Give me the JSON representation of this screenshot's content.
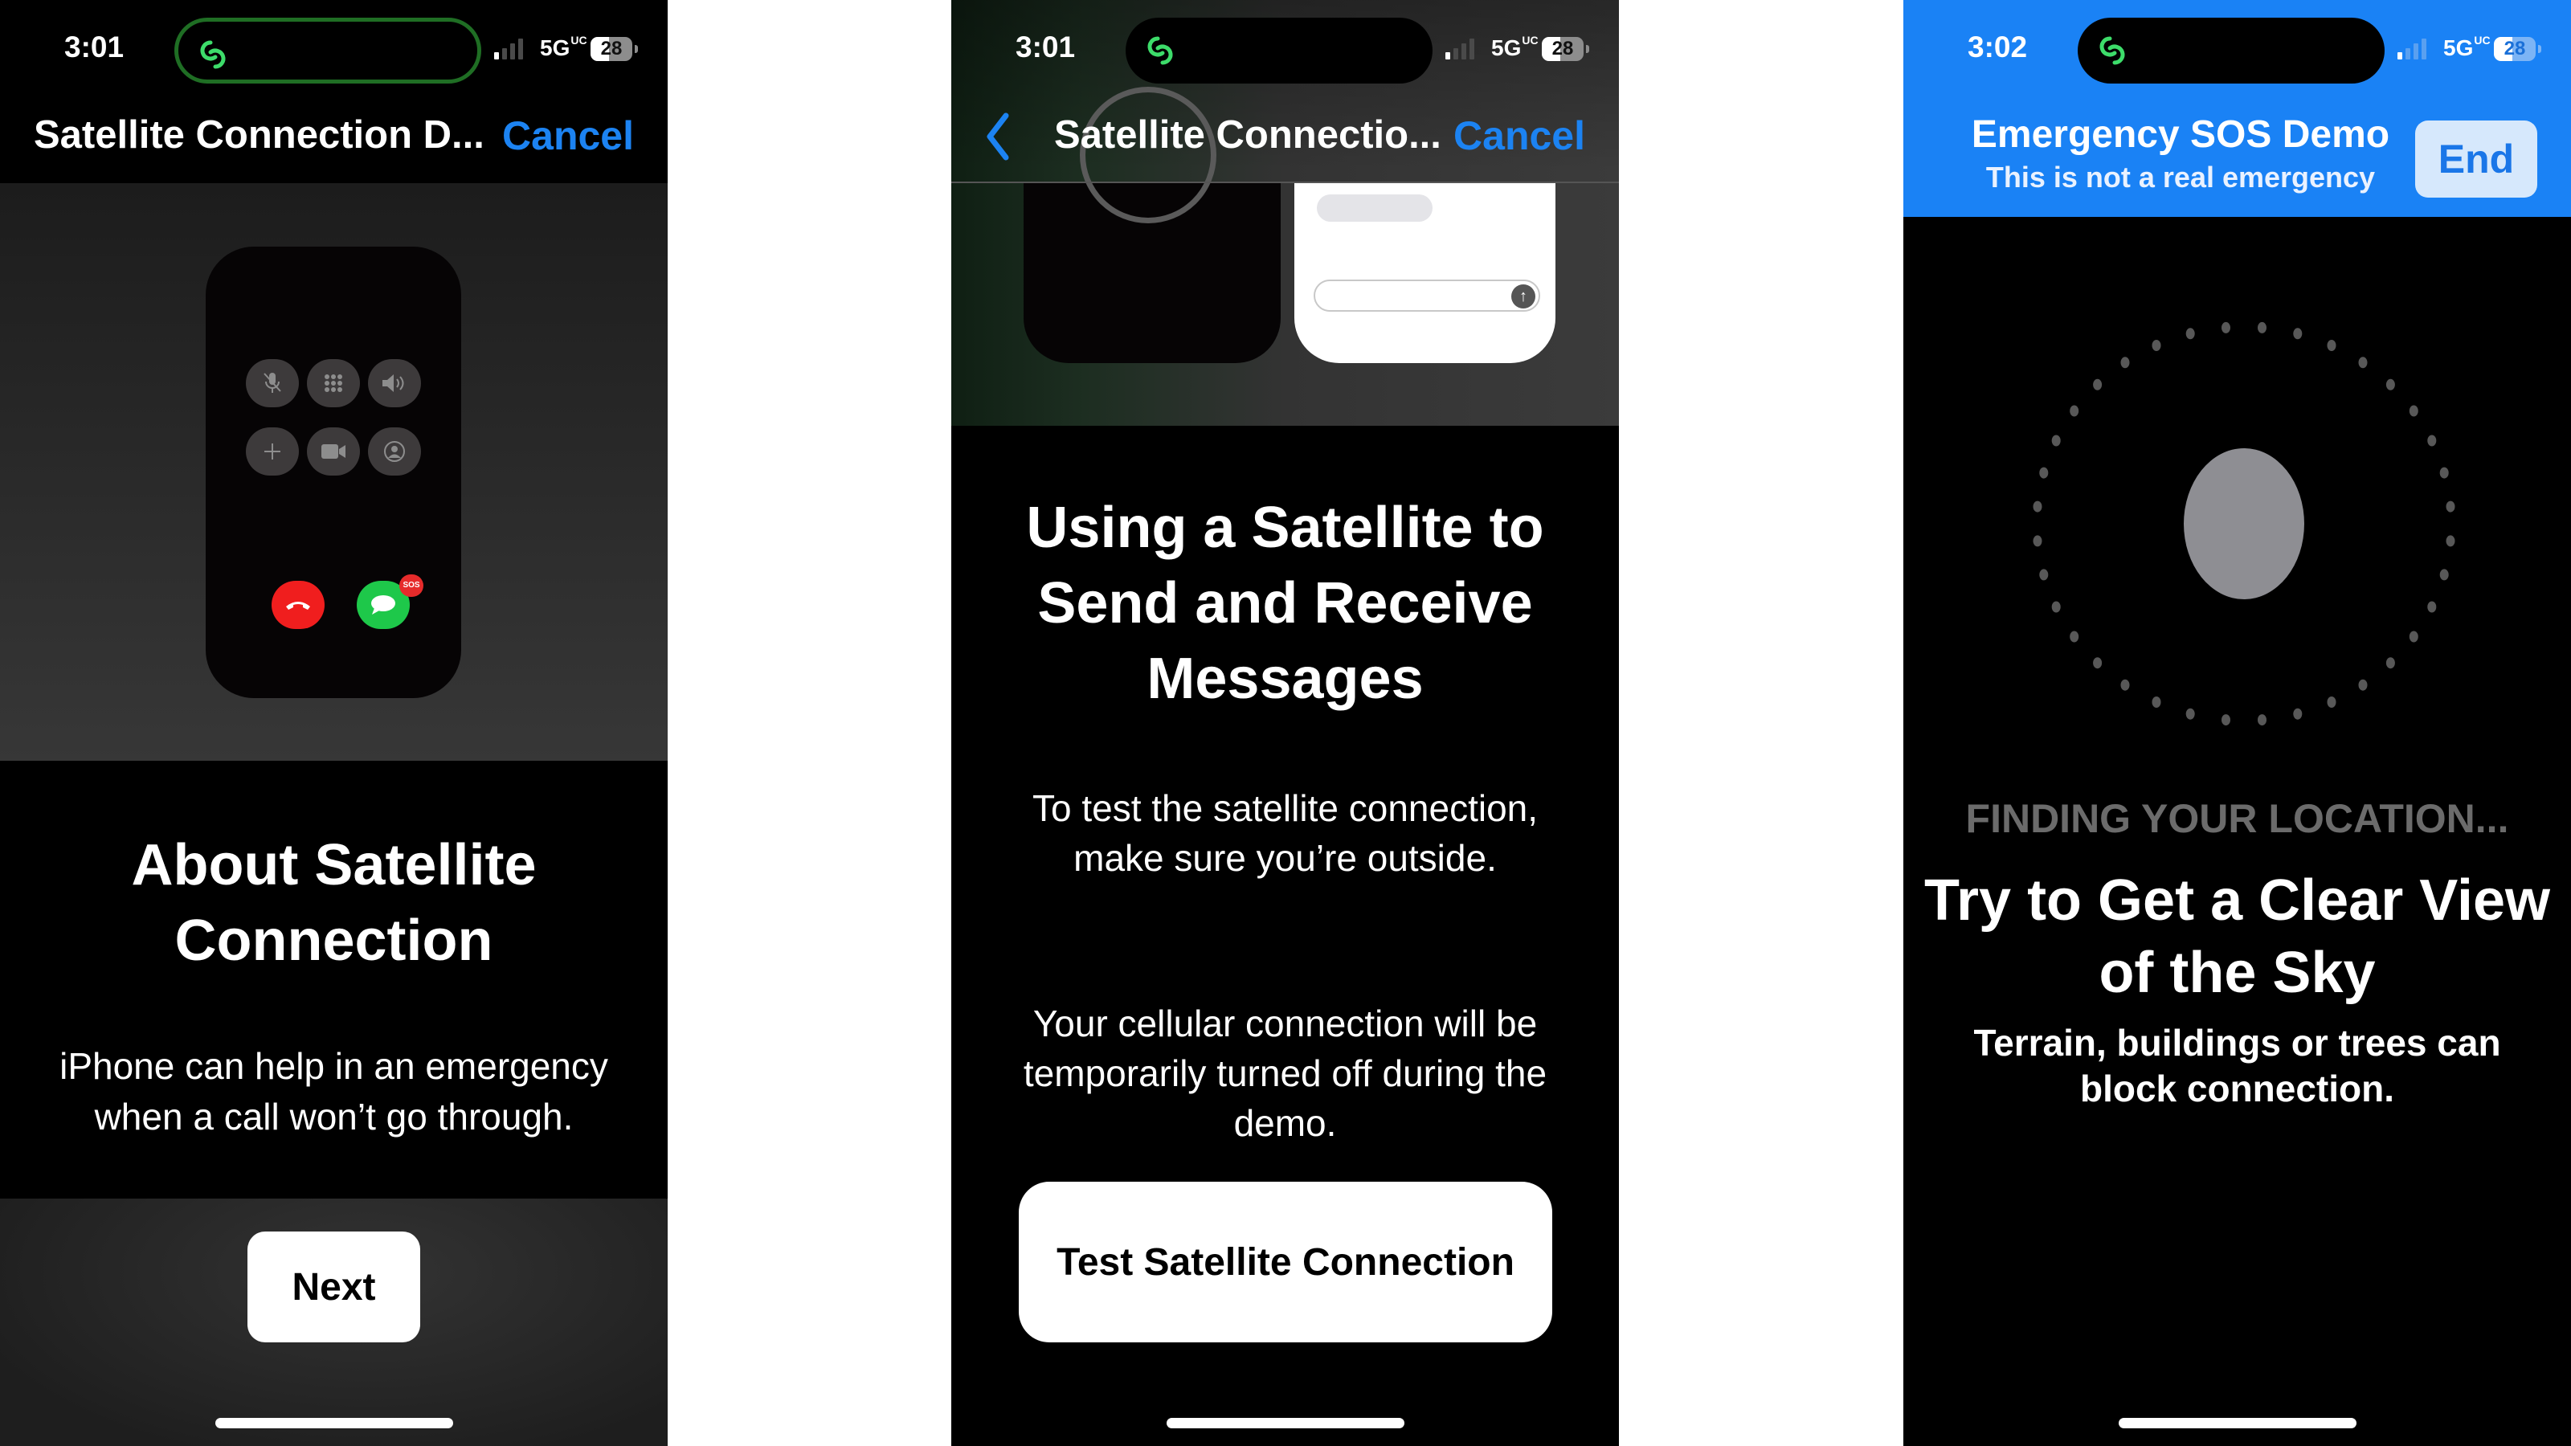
{
  "screens": [
    {
      "status": {
        "time": "3:01",
        "network": "5G",
        "network_sup": "UC",
        "battery": "28",
        "signal_bars_on": 1,
        "signal_bars_total": 4,
        "dynamic_island_icon": "satellite-link-icon"
      },
      "nav": {
        "title": "Satellite Connection D...",
        "cancel_label": "Cancel"
      },
      "illustration": {
        "controls": [
          "mute-icon",
          "keypad-icon",
          "speaker-icon",
          "add-call-icon",
          "facetime-icon",
          "contacts-icon"
        ],
        "end_call_icon": "end-call-icon",
        "message_icon": "message-bubble-icon",
        "sos_badge": "SOS"
      },
      "title": "About Satellite Connection",
      "body": "iPhone can help in an emergency when a call won’t go through.",
      "button_label": "Next"
    },
    {
      "status": {
        "time": "3:01",
        "network": "5G",
        "network_sup": "UC",
        "battery": "28",
        "signal_bars_on": 1,
        "signal_bars_total": 4,
        "dynamic_island_icon": "satellite-link-icon"
      },
      "nav": {
        "back_icon": "chevron-left-icon",
        "title": "Satellite Connectio...",
        "cancel_label": "Cancel"
      },
      "illustration": {
        "send_icon": "arrow-up-icon"
      },
      "title": "Using a Satellite to Send and Receive Messages",
      "body1": "To test the satellite connection, make sure you’re outside.",
      "body2": "Your cellular connection will be temporarily turned off during the demo.",
      "button_label": "Test Satellite Connection"
    },
    {
      "status": {
        "time": "3:02",
        "network": "5G",
        "network_sup": "UC",
        "battery": "28",
        "signal_bars_on": 1,
        "signal_bars_total": 4,
        "dynamic_island_icon": "satellite-link-icon"
      },
      "header": {
        "title": "Emergency SOS Demo",
        "subtitle": "This is not a real emergency",
        "end_label": "End"
      },
      "finder": {
        "dot_count": 36
      },
      "status_label": "FINDING YOUR LOCATION...",
      "title": "Try to Get a Clear View of the Sky",
      "body": "Terrain, buildings or trees can block connection."
    }
  ],
  "colors": {
    "accent_blue": "#1c83f2",
    "sos_header_blue": "#1a82f5",
    "end_button_bg": "#d6e8fc",
    "island_green": "#3ddc6a",
    "end_call_red": "#f01e1e",
    "message_green": "#1ec84a"
  }
}
